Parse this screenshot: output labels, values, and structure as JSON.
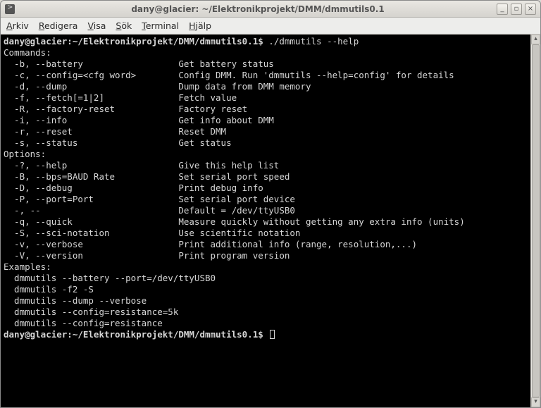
{
  "window": {
    "title": "dany@glacier: ~/Elektronikprojekt/DMM/dmmutils0.1"
  },
  "menubar": {
    "items": [
      {
        "label": "Arkiv",
        "ul": "A"
      },
      {
        "label": "Redigera",
        "ul": "R"
      },
      {
        "label": "Visa",
        "ul": "V"
      },
      {
        "label": "Sök",
        "ul": "S"
      },
      {
        "label": "Terminal",
        "ul": "T"
      },
      {
        "label": "Hjälp",
        "ul": "H"
      }
    ]
  },
  "window_buttons": {
    "min": "_",
    "max": "▫",
    "close": "×"
  },
  "prompt1": "dany@glacier:~/Elektronikprojekt/DMM/dmmutils0.1$ ",
  "cmd1": "./dmmutils --help",
  "commands_header": "Commands:",
  "commands": [
    {
      "flag": "  -b, --battery",
      "desc": "Get battery status"
    },
    {
      "flag": "  -c, --config=<cfg word>",
      "desc": "Config DMM. Run 'dmmutils --help=config' for details"
    },
    {
      "flag": "  -d, --dump",
      "desc": "Dump data from DMM memory"
    },
    {
      "flag": "  -f, --fetch[=1|2]",
      "desc": "Fetch value"
    },
    {
      "flag": "  -R, --factory-reset",
      "desc": "Factory reset"
    },
    {
      "flag": "  -i, --info",
      "desc": "Get info about DMM"
    },
    {
      "flag": "  -r, --reset",
      "desc": "Reset DMM"
    },
    {
      "flag": "  -s, --status",
      "desc": "Get status"
    }
  ],
  "options_header": "Options:",
  "options": [
    {
      "flag": "  -?, --help",
      "desc": "Give this help list"
    },
    {
      "flag": "  -B, --bps=BAUD Rate",
      "desc": "Set serial port speed"
    },
    {
      "flag": "  -D, --debug",
      "desc": "Print debug info"
    },
    {
      "flag": "  -P, --port=Port",
      "desc": "Set serial port device"
    },
    {
      "flag": "  -, --",
      "desc": "Default = /dev/ttyUSB0"
    },
    {
      "flag": "  -q, --quick",
      "desc": "Measure quickly without getting any extra info (units)"
    },
    {
      "flag": "  -S, --sci-notation",
      "desc": "Use scientific notation"
    },
    {
      "flag": "  -v, --verbose",
      "desc": "Print additional info (range, resolution,...)"
    },
    {
      "flag": "  -V, --version",
      "desc": "Print program version"
    }
  ],
  "examples_header": "Examples:",
  "examples": [
    "  dmmutils --battery --port=/dev/ttyUSB0",
    "  dmmutils -f2 -S",
    "  dmmutils --dump --verbose",
    "  dmmutils --config=resistance=5k",
    "  dmmutils --config=resistance"
  ],
  "prompt2": "dany@glacier:~/Elektronikprojekt/DMM/dmmutils0.1$ "
}
